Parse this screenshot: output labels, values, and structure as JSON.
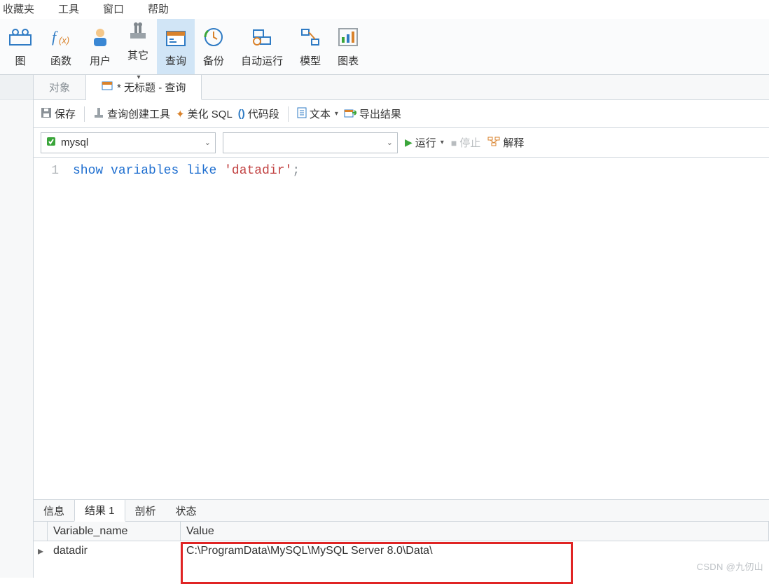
{
  "menu": {
    "favorites": "收藏夹",
    "tools": "工具",
    "window": "窗口",
    "help": "帮助"
  },
  "ribbon": {
    "view": "图",
    "func": "函数",
    "user": "用户",
    "other": "其它",
    "query": "查询",
    "backup": "备份",
    "autorun": "自动运行",
    "model": "模型",
    "chart": "图表"
  },
  "tabs": {
    "objects": "对象",
    "query": "* 无标题 - 查询"
  },
  "toolbar": {
    "save": "保存",
    "query_builder": "查询创建工具",
    "beautify_sql": "美化 SQL",
    "snippets": "代码段",
    "text": "文本",
    "export": "导出结果"
  },
  "controls": {
    "connection": "mysql",
    "database": "",
    "run": "运行",
    "stop": "停止",
    "explain": "解释"
  },
  "editor": {
    "line_no": "1",
    "kw_show": "show",
    "kw_variables": "variables",
    "kw_like": "like",
    "str_datadir": "'datadir'",
    "semicolon": ";"
  },
  "result_tabs": {
    "info": "信息",
    "result1": "结果 1",
    "profile": "剖析",
    "status": "状态"
  },
  "result_grid": {
    "col_variable": "Variable_name",
    "col_value": "Value",
    "row_marker": "▸",
    "row_variable": "datadir",
    "row_value": "C:\\ProgramData\\MySQL\\MySQL Server 8.0\\Data\\"
  },
  "watermark": "CSDN @九仞山"
}
